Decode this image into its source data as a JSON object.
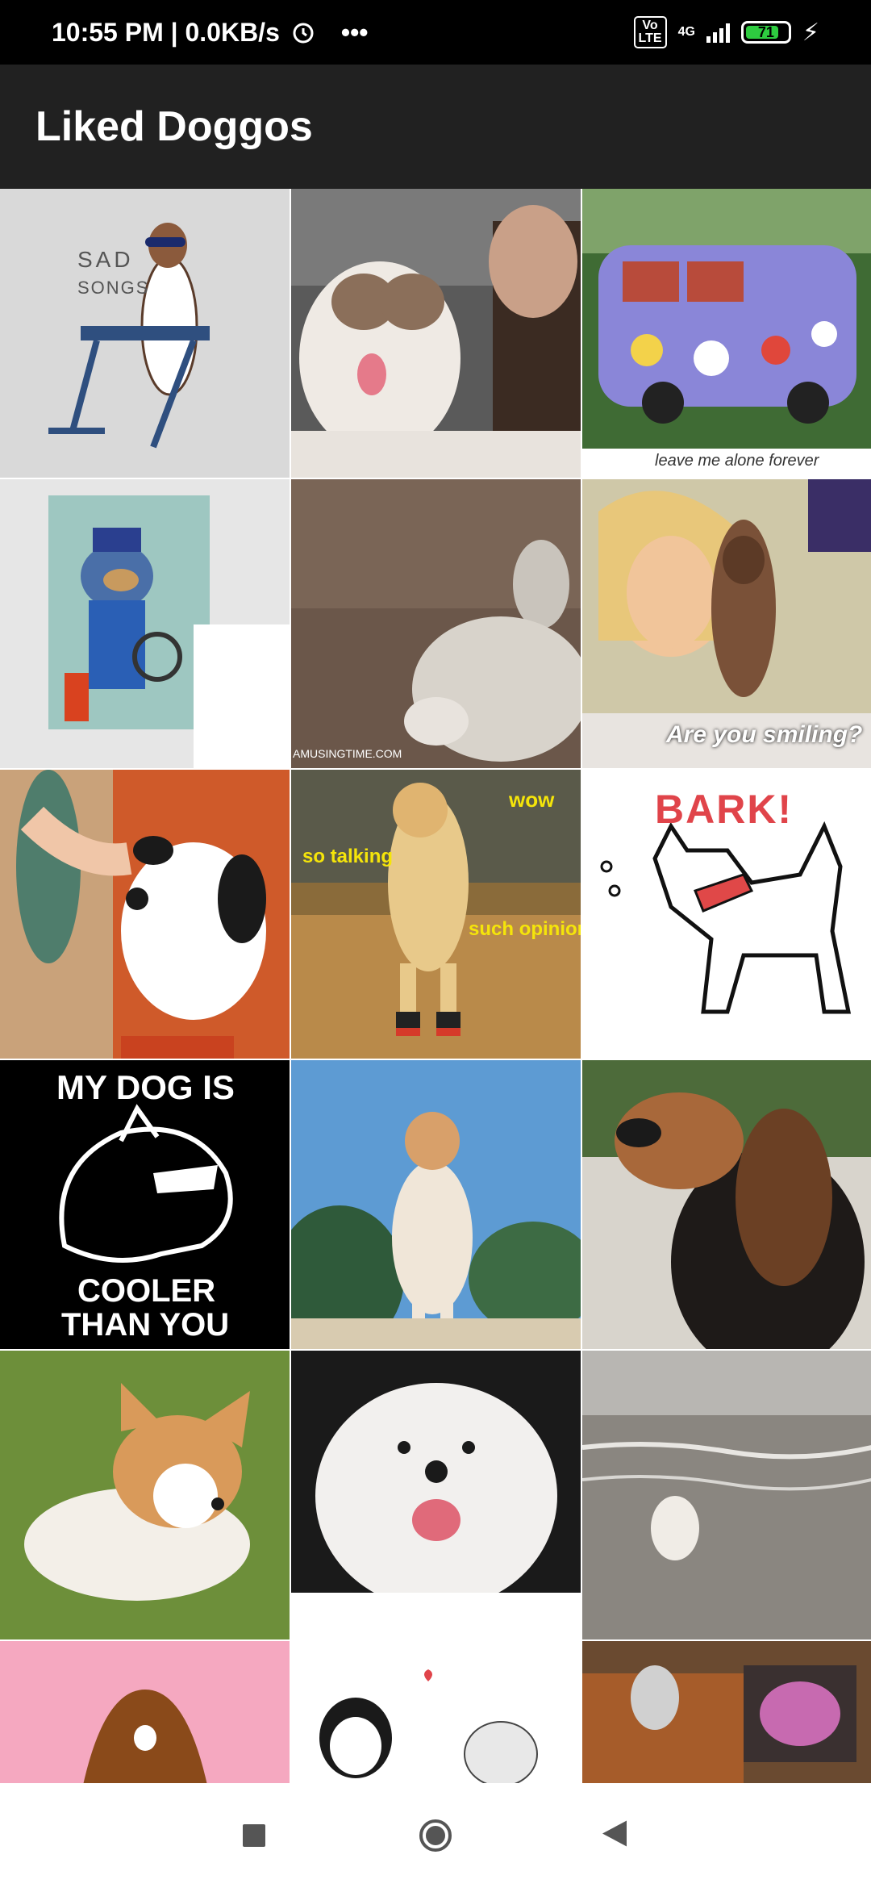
{
  "status_bar": {
    "time_speed": "10:55 PM | 0.0KB/s",
    "alarm_icon": "alarm-clock-icon",
    "more": "•••",
    "volte": "Vo\nLTE",
    "network": "4G",
    "battery": "71",
    "charging_icon": "lightning-icon"
  },
  "app_bar": {
    "title": "Liked Doggos"
  },
  "tiles": {
    "t1": {
      "line1": "SAD",
      "line2": "SONGS"
    },
    "t3": {
      "caption": "leave me alone forever"
    },
    "t5": {
      "caption": "AMUSINGTIME.COM"
    },
    "t6": {
      "caption": "Are you smiling?"
    },
    "t8": {
      "wow": "wow",
      "so_talking": "so talking",
      "such_opinion": "such opinion"
    },
    "t9": {
      "caption": "BARK!"
    },
    "t10": {
      "line1": "MY DOG IS",
      "line2": "COOLER",
      "line3": "THAN YOU"
    }
  },
  "nav_bar": {
    "recents_icon": "square-recents-icon",
    "home_icon": "circle-home-icon",
    "back_icon": "triangle-back-icon"
  }
}
